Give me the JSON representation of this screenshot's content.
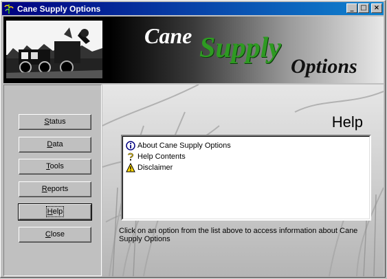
{
  "window": {
    "title": "Cane Supply Options",
    "minimize": "_",
    "maximize": "□",
    "close": "×"
  },
  "banner": {
    "logo_word1": "Cane",
    "logo_word2": "Supply",
    "logo_word3": "Options"
  },
  "nav": {
    "items": [
      {
        "label": "Status",
        "underline": "S",
        "rest": "tatus"
      },
      {
        "label": "Data",
        "underline": "D",
        "rest": "ata"
      },
      {
        "label": "Tools",
        "underline": "T",
        "rest": "ools"
      },
      {
        "label": "Reports",
        "underline": "R",
        "rest": "eports"
      },
      {
        "label": "Help",
        "underline": "H",
        "rest": "elp"
      },
      {
        "label": "Close",
        "underline": "C",
        "rest": "lose"
      }
    ],
    "active": "Help"
  },
  "help": {
    "heading": "Help",
    "list": [
      {
        "label": "About Cane Supply Options",
        "icon": "info-icon"
      },
      {
        "label": "Help Contents",
        "icon": "question-icon"
      },
      {
        "label": "Disclaimer",
        "icon": "warning-icon"
      }
    ],
    "instructions": "Click on an option from the list above to access information about Cane Supply Options"
  },
  "colors": {
    "title_bar": "#000080",
    "logo_green": "#2e9a22",
    "window_face": "#c0c0c0"
  }
}
